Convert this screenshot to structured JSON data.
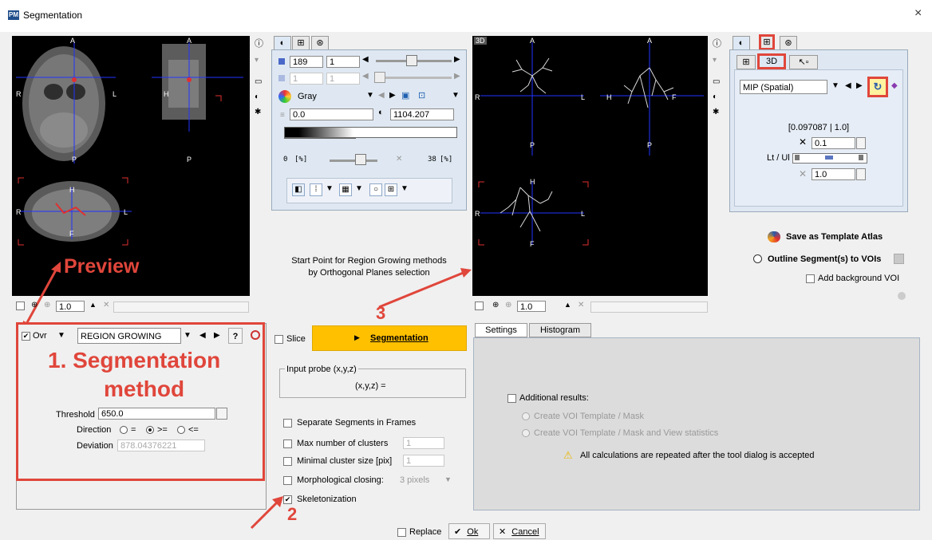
{
  "window": {
    "title": "Segmentation",
    "close": "×"
  },
  "annotations": {
    "preview": "Preview",
    "method_line1": "1. Segmentation",
    "method_line2": "method",
    "num2": "2",
    "num3": "3"
  },
  "left_viewer": {
    "labels": {
      "a": "A",
      "p": "P",
      "r": "R",
      "l": "L",
      "h": "H",
      "f": "F"
    },
    "zoom_value": "1.0"
  },
  "left_tool": {
    "tabs": [
      "◐",
      "⊞",
      "⊛"
    ],
    "slice_value": "189",
    "frame_value": "1",
    "frame2_value": "1",
    "frame3_value": "1",
    "colormap": "Gray",
    "min_value": "0.0",
    "max_value": "1104.207",
    "range_min": "0",
    "range_unit": "[%]",
    "range_max": "38",
    "range_unit2": "[%]"
  },
  "center_text": {
    "line1": "Start Point for Region Growing methods",
    "line2": "by Orthogonal Planes selection"
  },
  "right_viewer": {
    "tag": "3D",
    "labels": {
      "a": "A",
      "p": "P",
      "r": "R",
      "l": "L",
      "h": "H",
      "f": "F"
    },
    "zoom_value": "1.0"
  },
  "right_tool": {
    "tabs": [
      "◐",
      "⊞",
      "⊛"
    ],
    "subtabs": [
      "⊞",
      "3D",
      "↖▫"
    ],
    "projection": "MIP (Spatial)",
    "range_text": "[0.097087 | 1.0]",
    "x_value": "0.1",
    "ltul_label": "Lt / Ul",
    "x2_value": "1.0"
  },
  "right_actions": {
    "save_atlas": "Save as Template Atlas",
    "outline": "Outline Segment(s) to VOIs",
    "add_bg": "Add background VOI"
  },
  "method_panel": {
    "ovr": "Ovr",
    "method": "REGION GROWING",
    "help": "?",
    "threshold_label": "Threshold",
    "threshold_value": "650.0",
    "direction_label": "Direction",
    "dir_eq": "=",
    "dir_ge": ">=",
    "dir_le": "<=",
    "deviation_label": "Deviation",
    "deviation_value": "878.04376221"
  },
  "segment_controls": {
    "slice_label": "Slice",
    "segmentation_label": "Segmentation",
    "input_probe_label": "Input probe (x,y,z)",
    "probe_value": "(x,y,z) =",
    "separate_label": "Separate Segments in Frames",
    "max_clusters_label": "Max number of clusters",
    "max_clusters_value": "1",
    "min_cluster_label": "Minimal cluster size [pix]",
    "min_cluster_value": "1",
    "morph_label": "Morphological closing:",
    "morph_value": "3 pixels",
    "skeleton_label": "Skeletonization"
  },
  "settings_panel": {
    "tabs": [
      "Settings",
      "Histogram"
    ],
    "additional": "Additional results:",
    "opt1": "Create VOI Template / Mask",
    "opt2": "Create VOI Template / Mask and View statistics",
    "warning": "All calculations are repeated after the tool dialog is accepted"
  },
  "bottom": {
    "replace": "Replace",
    "ok": "Ok",
    "cancel": "Cancel"
  },
  "colors": {
    "accent_red": "#e0463b",
    "seg_button": "#ffc000",
    "viewer_bg": "#000000"
  }
}
